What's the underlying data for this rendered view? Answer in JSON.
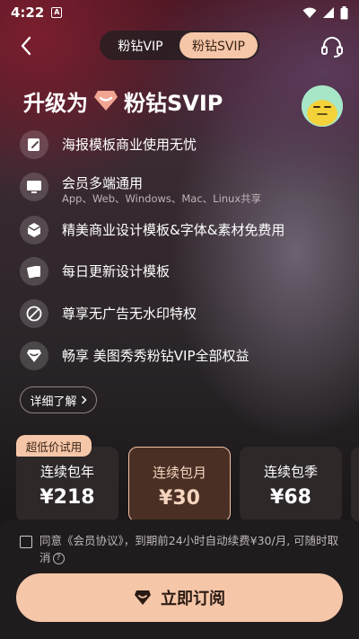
{
  "status": {
    "time": "4:22",
    "badge": "A"
  },
  "tabs": [
    {
      "label": "粉钻VIP",
      "active": false
    },
    {
      "label": "粉钻SVIP",
      "active": true
    }
  ],
  "hero": {
    "prefix": "升级为",
    "title": "粉钻SVIP"
  },
  "features": [
    {
      "icon": "edit-poster-icon",
      "title": "海报模板商业使用无忧"
    },
    {
      "icon": "monitor-icon",
      "title": "会员多端通用",
      "sub": "App、Web、Windows、Mac、Linux共享"
    },
    {
      "icon": "box-icon",
      "title": "精美商业设计模板&字体&素材免费用"
    },
    {
      "icon": "cards-icon",
      "title": "每日更新设计模板"
    },
    {
      "icon": "no-ads-icon",
      "title": "尊享无广告无水印特权"
    },
    {
      "icon": "diamond-icon",
      "title": "畅享 美图秀秀粉钻VIP全部权益"
    }
  ],
  "detail_button": "详细了解",
  "plans": {
    "tag": "超低价试用",
    "items": [
      {
        "name": "连续包年",
        "price": "¥218",
        "selected": false
      },
      {
        "name": "连续包月",
        "price": "¥30",
        "selected": true
      },
      {
        "name": "连续包季",
        "price": "¥68",
        "selected": false
      }
    ]
  },
  "agreement": {
    "text": "同意《会员协议》，到期前24小时自动续费¥30/月, 可随时取消",
    "checked": false
  },
  "subscribe_button": "立即订阅",
  "colors": {
    "accent": "#f5c6a8",
    "accent_text": "#3a2418",
    "selected_plan_bg": "#4a2f24",
    "diamond": "#f0a592"
  }
}
